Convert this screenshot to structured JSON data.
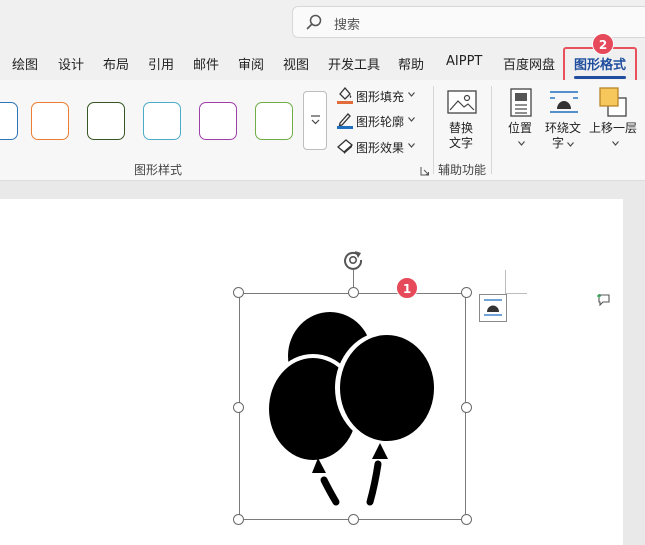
{
  "search": {
    "placeholder": "搜索",
    "icon": "search-icon"
  },
  "tabs": [
    {
      "label": "绘图"
    },
    {
      "label": "设计"
    },
    {
      "label": "布局"
    },
    {
      "label": "引用"
    },
    {
      "label": "邮件"
    },
    {
      "label": "审阅"
    },
    {
      "label": "视图"
    },
    {
      "label": "开发工具"
    },
    {
      "label": "帮助"
    },
    {
      "label": "AIPPT"
    },
    {
      "label": "百度网盘"
    },
    {
      "label": "图形格式",
      "active": true
    }
  ],
  "badges": {
    "tab_step": "2",
    "shape_step": "1"
  },
  "ribbon": {
    "style_swatches": [
      "#2e75b6",
      "#ed7d31",
      "#375623",
      "#4bacc6",
      "#9e3fa8",
      "#70ad47"
    ],
    "style_group_label": "图形样式",
    "fill_label": "图形填充",
    "outline_label": "图形轮廓",
    "effects_label": "图形效果",
    "alt_text_line1": "替换",
    "alt_text_line2": "文字",
    "accessibility_group_label": "辅助功能",
    "position_label": "位置",
    "wrap_text_line1": "环绕文",
    "wrap_text_line2": "字",
    "bring_forward_label": "上移一层",
    "accent_fill": "#e26b3a",
    "accent_outline": "#1f6fbf"
  }
}
